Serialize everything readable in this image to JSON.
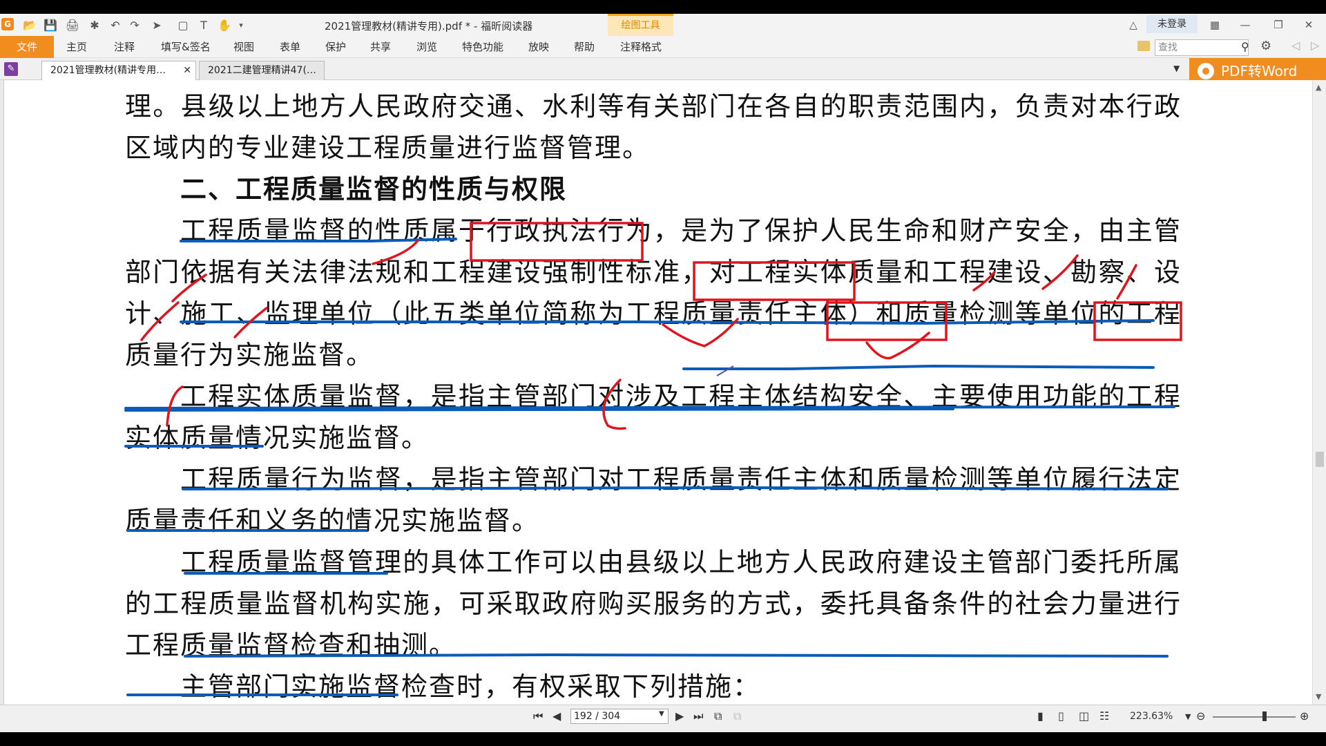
{
  "window": {
    "title": "2021管理教材(精讲专用).pdf * - 福昕阅读器",
    "context_tab": "绘图工具",
    "login": "未登录"
  },
  "ribbon": {
    "file": "文件",
    "tabs": [
      "主页",
      "注释",
      "填写&签名",
      "视图",
      "表单",
      "保护",
      "共享",
      "浏览",
      "特色功能",
      "放映",
      "帮助",
      "注释格式"
    ],
    "search_placeholder": "查找"
  },
  "doc_tabs": [
    {
      "label": "2021管理教材(精讲专用…",
      "active": true
    },
    {
      "label": "2021二建管理精讲47(…",
      "active": false
    }
  ],
  "promo": {
    "label": "PDF转Word"
  },
  "document": {
    "paragraphs": [
      "理。县级以上地方人民政府交通、水利等有关部门在各自的职责范围内，负责对本行政区域内的专业建设工程质量进行监督管理。",
      "二、工程质量监督的性质与权限",
      "工程质量监督的性质属于行政执法行为，是为了保护人民生命和财产安全，由主管部门依据有关法律法规和工程建设强制性标准，对工程实体质量和工程建设、勘察、设计、施工、监理单位（此五类单位简称为工程质量责任主体）和质量检测等单位的工程质量行为实施监督。",
      "工程实体质量监督，是指主管部门对涉及工程主体结构安全、主要使用功能的工程实体质量情况实施监督。",
      "工程质量行为监督，是指主管部门对工程质量责任主体和质量检测等单位履行法定质量责任和义务的情况实施监督。",
      "工程质量监督管理的具体工作可以由县级以上地方人民政府建设主管部门委托所属的工程质量监督机构实施，可采取政府购买服务的方式，委托具备条件的社会力量进行工程质量监督检查和抽测。",
      "主管部门实施监督检查时，有权采取下列措施："
    ]
  },
  "statusbar": {
    "page": "192 / 304",
    "zoom": "223.63%"
  },
  "colors": {
    "accent_orange": "#f18d1f",
    "ink_red": "#e0141e",
    "ink_blue": "#0b5cb8"
  }
}
